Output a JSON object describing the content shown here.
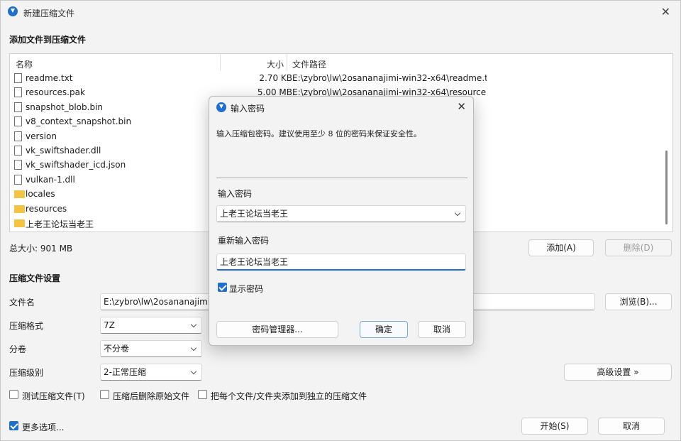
{
  "window": {
    "title": "新建压缩文件",
    "close_glyph": "✕"
  },
  "files_section": {
    "title": "添加文件到压缩文件"
  },
  "file_list": {
    "headers": {
      "name": "名称",
      "size": "大小",
      "path": "文件路径"
    },
    "rows": [
      {
        "icon": "document-icon",
        "name": "readme.txt",
        "size": "2.70 KB",
        "path": "E:\\zybro\\lw\\2osananajimi-win32-x64\\readme.txt"
      },
      {
        "icon": "document-icon",
        "name": "resources.pak",
        "size": "5.00 MB",
        "path": "E:\\zybro\\lw\\2osananajimi-win32-x64\\resource..."
      },
      {
        "icon": "document-icon",
        "name": "snapshot_blob.bin",
        "size": "",
        "path": ""
      },
      {
        "icon": "document-icon",
        "name": "v8_context_snapshot.bin",
        "size": "",
        "path": ""
      },
      {
        "icon": "document-icon",
        "name": "version",
        "size": "",
        "path": ""
      },
      {
        "icon": "document-icon",
        "name": "vk_swiftshader.dll",
        "size": "",
        "path": ""
      },
      {
        "icon": "document-icon",
        "name": "vk_swiftshader_icd.json",
        "size": "",
        "path": ""
      },
      {
        "icon": "document-icon",
        "name": "vulkan-1.dll",
        "size": "",
        "path": ""
      },
      {
        "icon": "folder-icon",
        "name": "locales",
        "size": "",
        "path": ""
      },
      {
        "icon": "folder-icon",
        "name": "resources",
        "size": "",
        "path": ""
      },
      {
        "icon": "folder-icon",
        "name": "上老王论坛当老王",
        "size": "",
        "path": ""
      }
    ]
  },
  "total_size": "总大小: 901 MB",
  "buttons": {
    "add": "添加(A)",
    "remove": "删除(D)",
    "browse": "浏览(B)...",
    "advanced": "高级设置 »",
    "start": "开始(S)",
    "cancel": "取消"
  },
  "settings": {
    "title": "压缩文件设置",
    "filename_label": "文件名",
    "filename_value": "E:\\zybro\\lw\\2osananajimi-w",
    "format_label": "压缩格式",
    "format_value": "7Z",
    "volume_label": "分卷",
    "volume_value": "不分卷",
    "level_label": "压缩级别",
    "level_value": "2-正常压缩",
    "options": {
      "test": "测试压缩文件(T)",
      "delete_after": "压缩后删除原始文件",
      "separate": "把每个文件/文件夹添加到独立的压缩文件"
    },
    "more_options": "更多选项..."
  },
  "dialog": {
    "title": "输入密码",
    "message": "输入压缩包密码。建议使用至少 8 位的密码来保证安全性。",
    "password_label": "输入密码",
    "password_value": "上老王论坛当老王",
    "confirm_label": "重新输入密码",
    "confirm_value": "上老王论坛当老王",
    "show_password": "显示密码",
    "manager_button": "密码管理器...",
    "ok_button": "确定",
    "cancel_button": "取消"
  },
  "colors": {
    "accent": "#1e6fd0",
    "folder": "#f4c342"
  }
}
